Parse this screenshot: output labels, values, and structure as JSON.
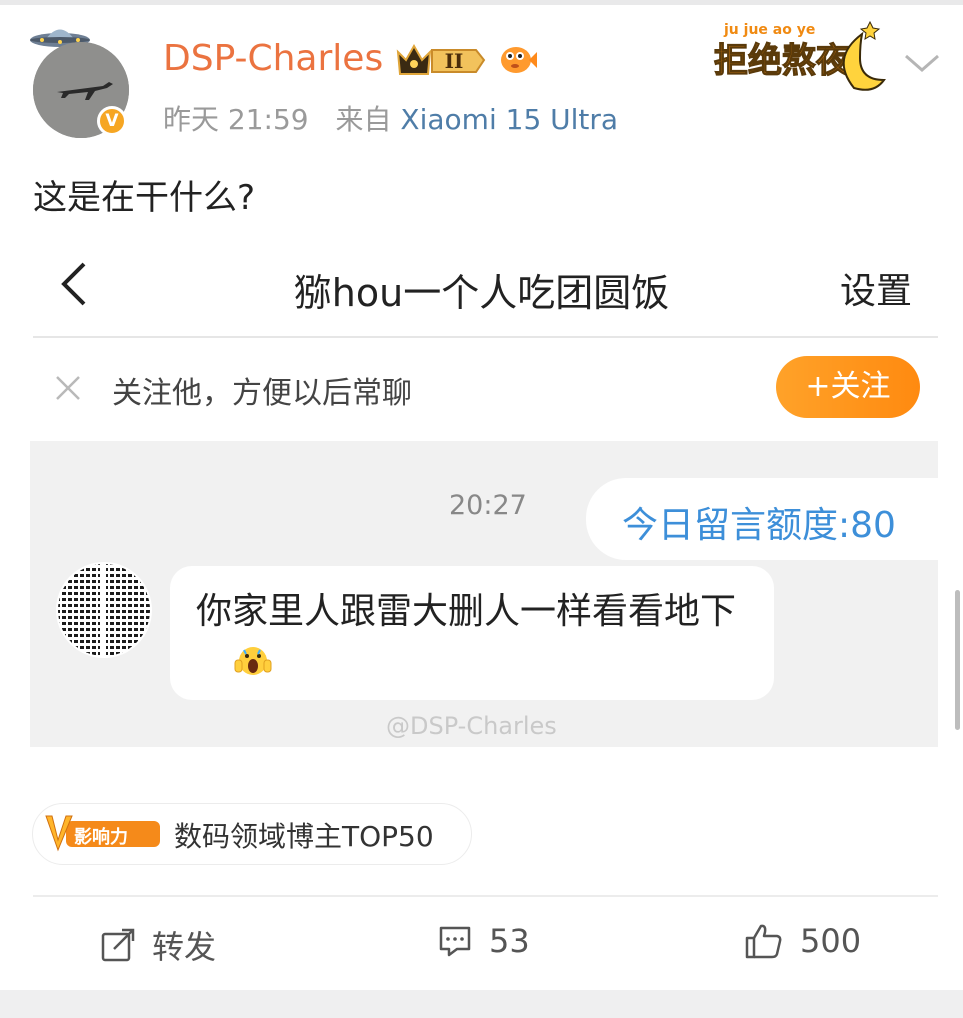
{
  "post": {
    "username": "DSP-Charles",
    "time": "昨天 21:59",
    "source_prefix": "来自",
    "device": "Xiaomi 15 Ultra",
    "badge_level": "II",
    "verified": "V",
    "text": "这是在干什么?",
    "sticker_text": "拒绝熬夜",
    "sticker_pinyin": "ju jue ao ye"
  },
  "screenshot": {
    "chat_title": "猕hou一个人吃团圆饭",
    "settings_label": "设置",
    "follow_hint": "关注他，方便以后常聊",
    "follow_button": "+关注",
    "timestamp": "20:27",
    "quota": "今日留言额度:80",
    "message": "你家里人跟雷大删人一样看看地下",
    "watermark": "@DSP-Charles"
  },
  "tag": {
    "logo_letter": "V",
    "logo_text": "影响力",
    "text": "数码领域博主TOP50"
  },
  "actions": {
    "repost_label": "转发",
    "comments": "53",
    "likes": "500"
  },
  "colors": {
    "username": "#eb7340",
    "device_link": "#4f7da8",
    "follow_button": "#ff9a1f",
    "quota_text": "#3d8fd9",
    "chat_background": "#f1f1f1"
  }
}
